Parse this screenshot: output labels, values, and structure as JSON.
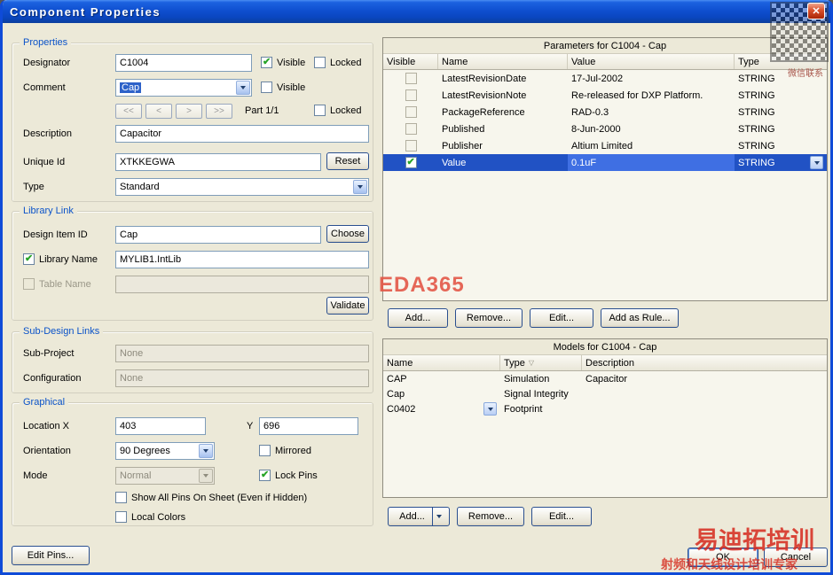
{
  "window": {
    "title": "Component Properties"
  },
  "icons": {
    "close": "✕",
    "sort": "▽"
  },
  "watermark": {
    "eda365": "EDA365",
    "qr_caption": "微信联系",
    "brand": "易迪拓培训",
    "tagline": "射频和天线设计培训专家"
  },
  "properties": {
    "section_title": "Properties",
    "designator": {
      "label": "Designator",
      "value": "C1004",
      "visible_label": "Visible",
      "visible_checked": true,
      "locked_label": "Locked",
      "locked_checked": false
    },
    "comment": {
      "label": "Comment",
      "value": "Cap",
      "visible_label": "Visible",
      "visible_checked": false
    },
    "part_nav": {
      "first": "<<",
      "prev": "<",
      "next": ">",
      "last": ">>",
      "part_label": "Part 1/1",
      "locked_label": "Locked",
      "locked_checked": false
    },
    "description": {
      "label": "Description",
      "value": "Capacitor"
    },
    "unique_id": {
      "label": "Unique Id",
      "value": "XTKKEGWA",
      "reset_label": "Reset"
    },
    "type": {
      "label": "Type",
      "value": "Standard"
    }
  },
  "library_link": {
    "section_title": "Library Link",
    "design_item_id": {
      "label": "Design Item ID",
      "value": "Cap",
      "choose_label": "Choose"
    },
    "library_name": {
      "label": "Library Name",
      "value": "MYLIB1.IntLib",
      "checked": true
    },
    "table_name": {
      "label": "Table Name",
      "value": "",
      "checked": false
    },
    "validate_label": "Validate"
  },
  "sub_design_links": {
    "section_title": "Sub-Design Links",
    "sub_project": {
      "label": "Sub-Project",
      "value": "None"
    },
    "configuration": {
      "label": "Configuration",
      "value": "None"
    }
  },
  "graphical": {
    "section_title": "Graphical",
    "location": {
      "label": "Location X",
      "x_value": "403",
      "y_label": "Y",
      "y_value": "696"
    },
    "orientation": {
      "label": "Orientation",
      "value": "90 Degrees",
      "mirrored_label": "Mirrored",
      "mirrored_checked": false
    },
    "mode": {
      "label": "Mode",
      "value": "Normal",
      "lock_pins_label": "Lock Pins",
      "lock_pins_checked": true
    },
    "show_all_pins_label": "Show All Pins On Sheet (Even if Hidden)",
    "show_all_pins_checked": false,
    "local_colors_label": "Local Colors",
    "local_colors_checked": false
  },
  "edit_pins_label": "Edit Pins...",
  "parameters": {
    "title": "Parameters for C1004 - Cap",
    "columns": [
      "Visible",
      "Name",
      "Value",
      "Type"
    ],
    "rows": [
      {
        "visible": false,
        "name": "LatestRevisionDate",
        "value": "17-Jul-2002",
        "type": "STRING",
        "selected": false
      },
      {
        "visible": false,
        "name": "LatestRevisionNote",
        "value": "Re-released for DXP Platform.",
        "type": "STRING",
        "selected": false
      },
      {
        "visible": false,
        "name": "PackageReference",
        "value": "RAD-0.3",
        "type": "STRING",
        "selected": false
      },
      {
        "visible": false,
        "name": "Published",
        "value": "8-Jun-2000",
        "type": "STRING",
        "selected": false
      },
      {
        "visible": false,
        "name": "Publisher",
        "value": "Altium Limited",
        "type": "STRING",
        "selected": false
      },
      {
        "visible": true,
        "name": "Value",
        "value": "0.1uF",
        "type": "STRING",
        "selected": true
      }
    ],
    "buttons": {
      "add": "Add...",
      "remove": "Remove...",
      "edit": "Edit...",
      "add_as_rule": "Add as Rule..."
    }
  },
  "models": {
    "title": "Models for C1004 - Cap",
    "columns": [
      "Name",
      "Type",
      "Description"
    ],
    "rows": [
      {
        "name": "CAP",
        "type": "Simulation",
        "description": "Capacitor",
        "has_dropdown": false
      },
      {
        "name": "Cap",
        "type": "Signal Integrity",
        "description": "",
        "has_dropdown": false
      },
      {
        "name": "C0402",
        "type": "Footprint",
        "description": "",
        "has_dropdown": true
      }
    ],
    "buttons": {
      "add": "Add...",
      "remove": "Remove...",
      "edit": "Edit..."
    }
  },
  "footer": {
    "ok": "OK",
    "cancel": "Cancel"
  }
}
